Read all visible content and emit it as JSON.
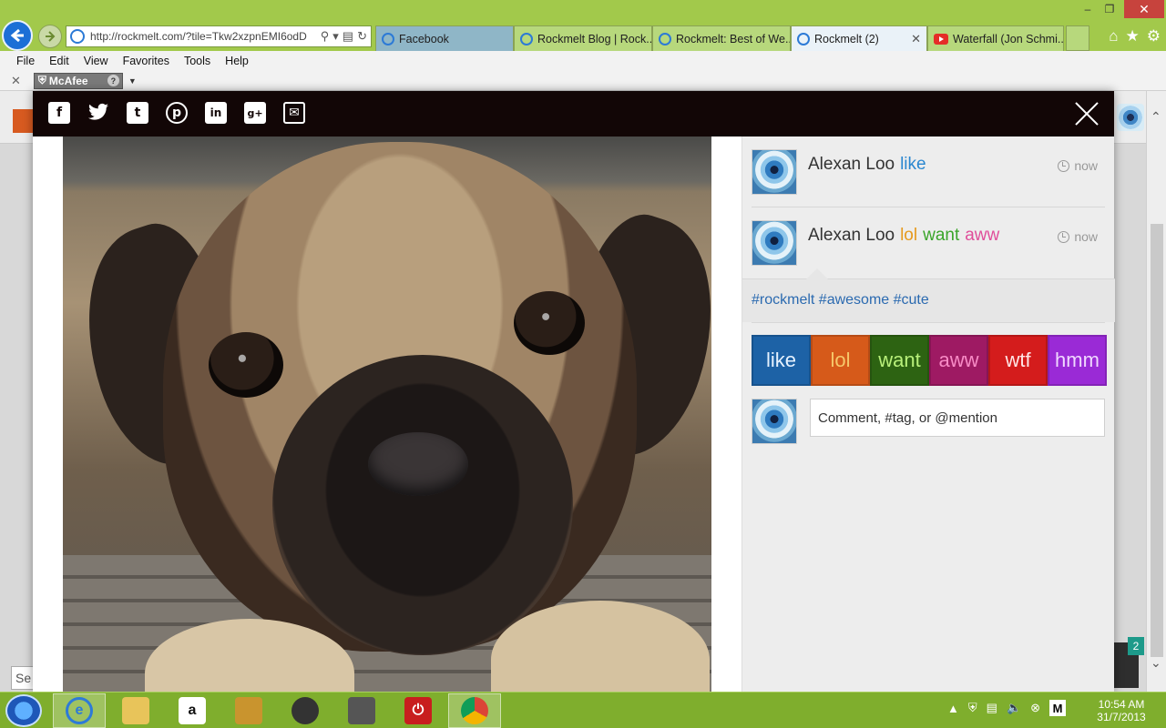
{
  "browser": {
    "url": "http://rockmelt.com/?tile=Tkw2xzpnEMI6odD",
    "tabs": [
      {
        "label": "Facebook"
      },
      {
        "label": "Rockmelt Blog | Rock..."
      },
      {
        "label": "Rockmelt: Best of We..."
      },
      {
        "label": "Rockmelt (2)"
      },
      {
        "label": "Waterfall (Jon Schmi..."
      }
    ],
    "menu": [
      "File",
      "Edit",
      "View",
      "Favorites",
      "Tools",
      "Help"
    ],
    "mcafee_label": "McAfee"
  },
  "share_icons": [
    "facebook-icon",
    "twitter-icon",
    "tumblr-icon",
    "pinterest-icon",
    "linkedin-icon",
    "googleplus-icon",
    "email-icon"
  ],
  "activity": [
    {
      "user": "Alexan Loo",
      "reactions": [
        "like"
      ],
      "time": "now"
    },
    {
      "user": "Alexan Loo",
      "reactions": [
        "lol",
        "want",
        "aww"
      ],
      "time": "now"
    }
  ],
  "tags": "#rockmelt #awesome #cute",
  "reaction_buttons": [
    "like",
    "lol",
    "want",
    "aww",
    "wtf",
    "hmm"
  ],
  "comment": {
    "placeholder": "Comment, #tag, or @mention"
  },
  "page": {
    "search_stub": "Se",
    "badge_count": "2"
  },
  "taskbar": {
    "time": "10:54 AM",
    "date": "31/7/2013"
  },
  "colors": {
    "like": "#2a87d0",
    "lol": "#e69a1e",
    "want": "#3aa52a",
    "aww": "#e04d9a",
    "tag": "#2b6ab0",
    "modal_bar": "#120606",
    "chrome": "#a2c94b"
  }
}
